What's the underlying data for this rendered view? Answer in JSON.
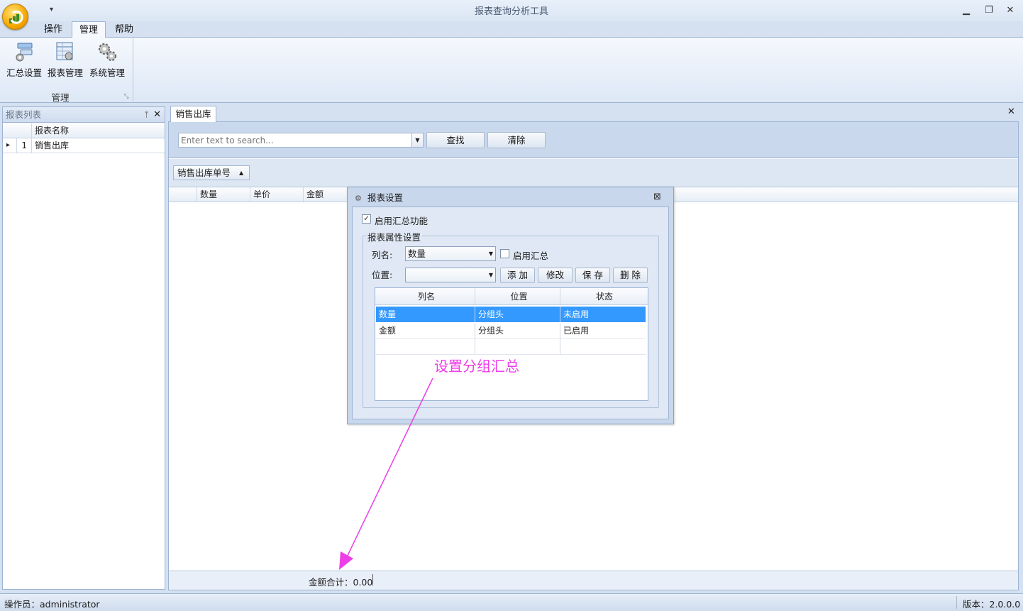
{
  "window": {
    "title": "报表查询分析工具",
    "qat_symbol": "▾",
    "minimize": "▁",
    "restore": "❐",
    "close": "✕"
  },
  "ribbon": {
    "tabs": [
      "操作",
      "管理",
      "帮助"
    ],
    "active_tab": "管理",
    "buttons": [
      "汇总设置",
      "报表管理",
      "系统管理"
    ],
    "group_label": "管理",
    "launcher": "⤡"
  },
  "left_panel": {
    "title": "报表列表",
    "pin": "ᛘ",
    "close": "✕",
    "columns": [
      "报表名称"
    ],
    "rows": [
      {
        "indicator": "▸",
        "num": "1",
        "name": "销售出库"
      }
    ]
  },
  "document": {
    "tab": "销售出库",
    "close": "✕",
    "search_placeholder": "Enter text to search...",
    "find_button": "查找",
    "clear_button": "清除",
    "group_chip": "销售出库单号",
    "group_chip_arrow": "▲",
    "columns": [
      "数量",
      "单价",
      "金额"
    ],
    "footer": "金额合计：0.00"
  },
  "dialog": {
    "title": "报表设置",
    "close": "⊠",
    "enable_summary_label": "启用汇总功能",
    "enable_summary_checked": true,
    "group_title": "报表属性设置",
    "column_label": "列名:",
    "column_value": "数量",
    "column_enable_label": "启用汇总",
    "position_label": "位置:",
    "position_value": "",
    "add_button": "添 加",
    "edit_button": "修改",
    "save_button": "保 存",
    "delete_button": "删 除",
    "grid_columns": [
      "列名",
      "位置",
      "状态"
    ],
    "grid_rows": [
      {
        "name": "数量",
        "position": "分组头",
        "status": "未启用"
      },
      {
        "name": "金额",
        "position": "分组头",
        "status": "已启用"
      }
    ]
  },
  "annotation": {
    "text": "设置分组汇总",
    "color": "#ee3ee8"
  },
  "status": {
    "operator": "操作员：administrator",
    "version": "版本：2.0.0.0"
  }
}
